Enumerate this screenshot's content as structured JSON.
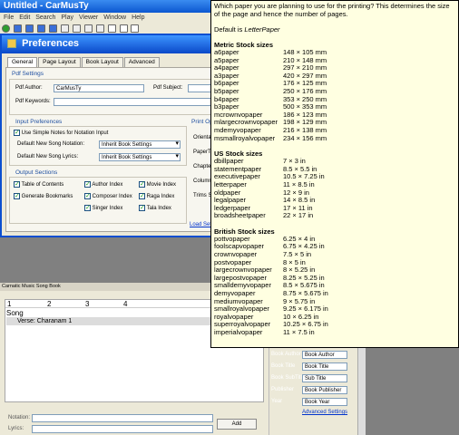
{
  "main_window": {
    "title": "Untitled - CarMusTy",
    "menu": [
      "File",
      "Edit",
      "Search",
      "Play",
      "Viewer",
      "Window",
      "Help"
    ]
  },
  "preferences": {
    "title": "Preferences",
    "tabs": [
      "General",
      "Page Layout",
      "Book Layout",
      "Advanced"
    ],
    "pdf_settings": {
      "title": "Pdf Settings",
      "author_label": "Pdf Author:",
      "author_value": "CarMusTy",
      "subject_label": "Pdf Subject:",
      "keywords_label": "Pdf Keywords:"
    },
    "input_preferences": {
      "title": "Input Preferences",
      "simple_notes_label": "Use Simple Notes for Notation Input",
      "song_notation_label": "Default New Song Notation:",
      "song_notation_value": "Inherit Book Settings",
      "song_lyrics_label": "Default New Song Lyrics:",
      "song_lyrics_value": "Inherit Book Settings"
    },
    "output_sections": {
      "title": "Output Sections",
      "items": [
        "Table of Contents",
        "Author Index",
        "Movie Index",
        "Generate Bookmarks",
        "Composer Index",
        "Raga Index",
        "Singer Index",
        "Tala Index"
      ]
    },
    "print_options": {
      "title": "Print Opti",
      "labels": [
        "Orienta",
        "PaperTyp",
        "Chapter",
        "Columns",
        "Trims St"
      ]
    },
    "load_settings_link": "Load Setti"
  },
  "songbook": {
    "title": "Carnatic Music Song Book",
    "ruler": [
      "1",
      "2",
      "3",
      "4"
    ],
    "song_label": "Song",
    "verse_label": "Verse: Charanam 1",
    "notation_label": "Notation:",
    "lyrics_label": "Lyrics:",
    "add_button": "Add"
  },
  "right_panel": {
    "rows": [
      {
        "label": "Book Author",
        "value": "Book Author"
      },
      {
        "label": "Book Title",
        "value": "Book Title"
      },
      {
        "label": "Book SubTitle",
        "value": "Sub Title"
      },
      {
        "label": "Publisher",
        "value": "Book Publisher"
      },
      {
        "label": "Year",
        "value": "Book Year"
      }
    ],
    "advanced_link": "Advanced Settings"
  },
  "tooltip": {
    "intro": "Which paper you are planning to use for the printing? This determines the size of the page and hence the number of pages.",
    "default_prefix": "Default is ",
    "default_value": "LetterPaper",
    "sections": [
      {
        "heading": "Metric Stock sizes",
        "rows": [
          [
            "a6paper",
            "148 × 105 mm"
          ],
          [
            "a5paper",
            "210 × 148 mm"
          ],
          [
            "a4paper",
            "297 × 210 mm"
          ],
          [
            "a3paper",
            "420 × 297 mm"
          ],
          [
            "b6paper",
            "176 × 125 mm"
          ],
          [
            "b5paper",
            "250 × 176 mm"
          ],
          [
            "b4paper",
            "353 × 250 mm"
          ],
          [
            "b3paper",
            "500 × 353 mm"
          ],
          [
            "mcrownvopaper",
            "186 × 123 mm"
          ],
          [
            "mlargecrownvopaper",
            "198 × 129 mm"
          ],
          [
            "mdemyvopaper",
            "216 × 138 mm"
          ],
          [
            "msmallroyalvopaper",
            "234 × 156 mm"
          ]
        ]
      },
      {
        "heading": "US Stock sizes",
        "rows": [
          [
            "dbillpaper",
            "7 × 3 in"
          ],
          [
            "statementpaper",
            "8.5 × 5.5 in"
          ],
          [
            "executivepaper",
            "10.5 × 7.25 in"
          ],
          [
            "letterpaper",
            "11 × 8.5 in"
          ],
          [
            "oldpaper",
            "12 × 9 in"
          ],
          [
            "legalpaper",
            "14 × 8.5 in"
          ],
          [
            "ledgerpaper",
            "17 × 11 in"
          ],
          [
            "broadsheetpaper",
            "22 × 17 in"
          ]
        ]
      },
      {
        "heading": "British Stock sizes",
        "rows": [
          [
            "pottvopaper",
            "6.25 × 4 in"
          ],
          [
            "foolscapvopaper",
            "6.75 × 4.25 in"
          ],
          [
            "crownvopaper",
            "7.5 × 5 in"
          ],
          [
            "postvopaper",
            "8 × 5 in"
          ],
          [
            "largecrownvopaper",
            "8 × 5.25 in"
          ],
          [
            "largepostvopaper",
            "8.25 × 5.25 in"
          ],
          [
            "smalldemyvopaper",
            "8.5 × 5.675 in"
          ],
          [
            "demyvopaper",
            "8.75 × 5.675 in"
          ],
          [
            "mediumvopaper",
            "9 × 5.75 in"
          ],
          [
            "smallroyalvopaper",
            "9.25 × 6.175 in"
          ],
          [
            "royalvopaper",
            "10 × 6.25 in"
          ],
          [
            "superroyalvopaper",
            "10.25 × 6.75 in"
          ],
          [
            "imperialvopaper",
            "11 × 7.5 in"
          ]
        ]
      }
    ]
  }
}
